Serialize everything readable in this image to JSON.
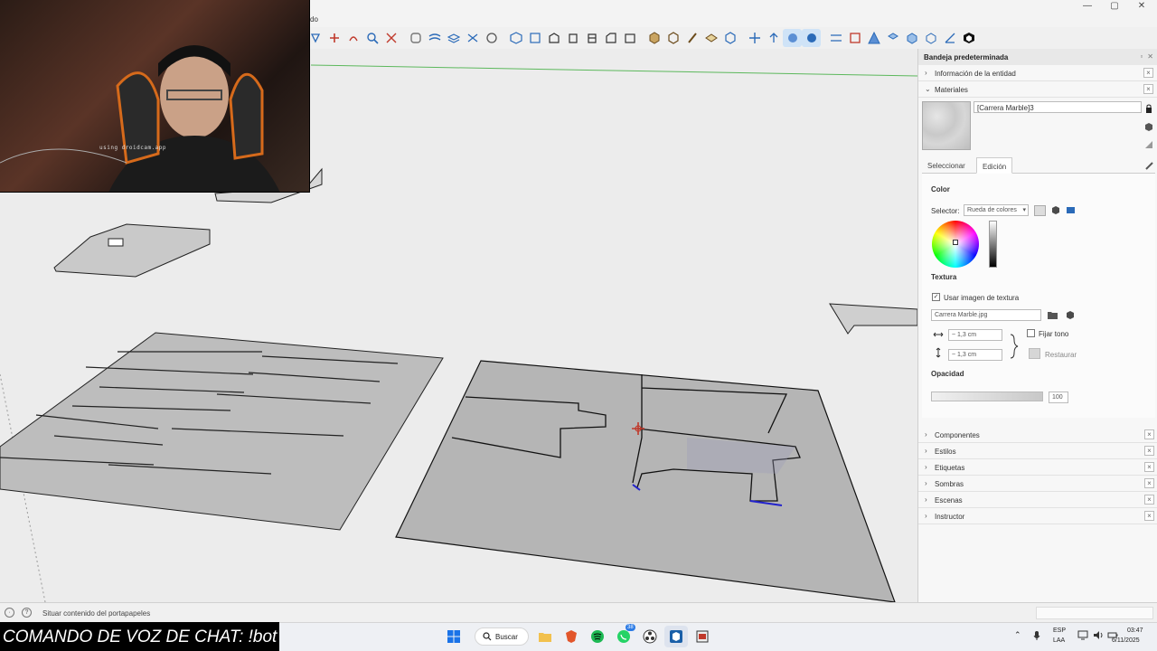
{
  "window": {
    "title_fragment": "do",
    "controls": [
      "—",
      "▢",
      "✕"
    ]
  },
  "webcam": {
    "watermark": "using droidcam.app"
  },
  "tray": {
    "title": "Bandeja predeterminada",
    "entity_info": "Información de la entidad",
    "materials": {
      "label": "Materiales",
      "name": "[Carrera Marble]3",
      "tabs": [
        "Seleccionar",
        "Edición"
      ],
      "active_tab": "Edición",
      "color_label": "Color",
      "selector_label": "Selector:",
      "selector_value": "Rueda de colores",
      "texture_label": "Textura",
      "use_texture_label": "Usar imagen de textura",
      "use_texture_checked": "✓",
      "texture_file": "Carrera Marble.jpg",
      "width_value": "~ 1,3 cm",
      "height_value": "~ 1,3 cm",
      "fix_tone_label": "Fijar tono",
      "restore_label": "Restaurar",
      "opacity_label": "Opacidad",
      "opacity_value": "100"
    },
    "panels": [
      "Componentes",
      "Estilos",
      "Etiquetas",
      "Sombras",
      "Escenas",
      "Instructor"
    ]
  },
  "statusbar": {
    "text": "Situar contenido del portapapeles"
  },
  "caption": "COMANDO DE VOZ DE CHAT: !bot",
  "taskbar": {
    "search_label": "Buscar",
    "whatsapp_badge": "38",
    "lang_top": "ESP",
    "lang_bottom": "LAA",
    "time": "03:47",
    "date": "6/11/2025"
  }
}
